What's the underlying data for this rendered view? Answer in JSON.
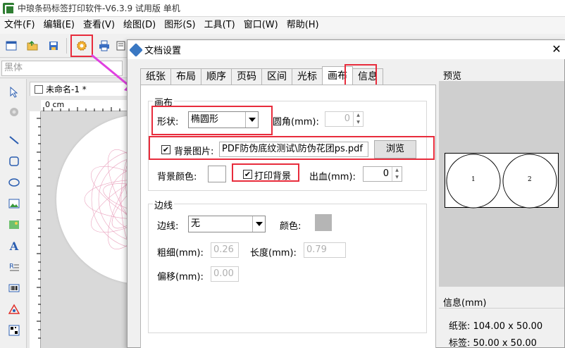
{
  "app": {
    "title": "中琅条码标签打印软件-V6.3.9 试用版 单机"
  },
  "menu": [
    {
      "label": "文件(F)"
    },
    {
      "label": "编辑(E)"
    },
    {
      "label": "查看(V)"
    },
    {
      "label": "绘图(D)"
    },
    {
      "label": "图形(S)"
    },
    {
      "label": "工具(T)"
    },
    {
      "label": "窗口(W)"
    },
    {
      "label": "帮助(H)"
    }
  ],
  "fontbar": {
    "font_name": "黑体"
  },
  "document": {
    "tab_title": "未命名-1 *",
    "ruler_unit": "0 cm"
  },
  "dialog": {
    "title": "文档设置",
    "close": "✕",
    "tabs": [
      "纸张",
      "布局",
      "顺序",
      "页码",
      "区间",
      "光标",
      "画布",
      "信息"
    ],
    "active_tab": "画布",
    "canvas_group": {
      "title": "画布",
      "shape_label": "形状:",
      "shape_value": "椭圆形",
      "corner_label": "圆角(mm):",
      "corner_value": "0",
      "bg_image_label": "背景图片:",
      "bg_image_path": "PDF防伪底纹测试\\防伪花团ps.pdf",
      "browse_label": "浏览",
      "bg_color_label": "背景颜色:",
      "print_bg_label": "打印背景",
      "bleed_label": "出血(mm):",
      "bleed_value": "0"
    },
    "border_group": {
      "title": "边线",
      "border_label": "边线:",
      "border_value": "无",
      "color_label": "颜色:",
      "thickness_label": "粗细(mm):",
      "thickness_value": "0.26",
      "length_label": "长度(mm):",
      "length_value": "0.79",
      "offset_label": "偏移(mm):",
      "offset_value": "0.00"
    },
    "preview": {
      "title": "预览",
      "label_1": "1",
      "label_2": "2"
    },
    "info": {
      "title": "信息(mm)",
      "paper_line": "纸张: 104.00 x 50.00",
      "label_line": "标签: 50.00 x 50.00"
    }
  },
  "colors": {
    "highlight": "#e82c3c",
    "arrow": "#e040e0",
    "border_color_swatch": "#b5b5b5"
  }
}
